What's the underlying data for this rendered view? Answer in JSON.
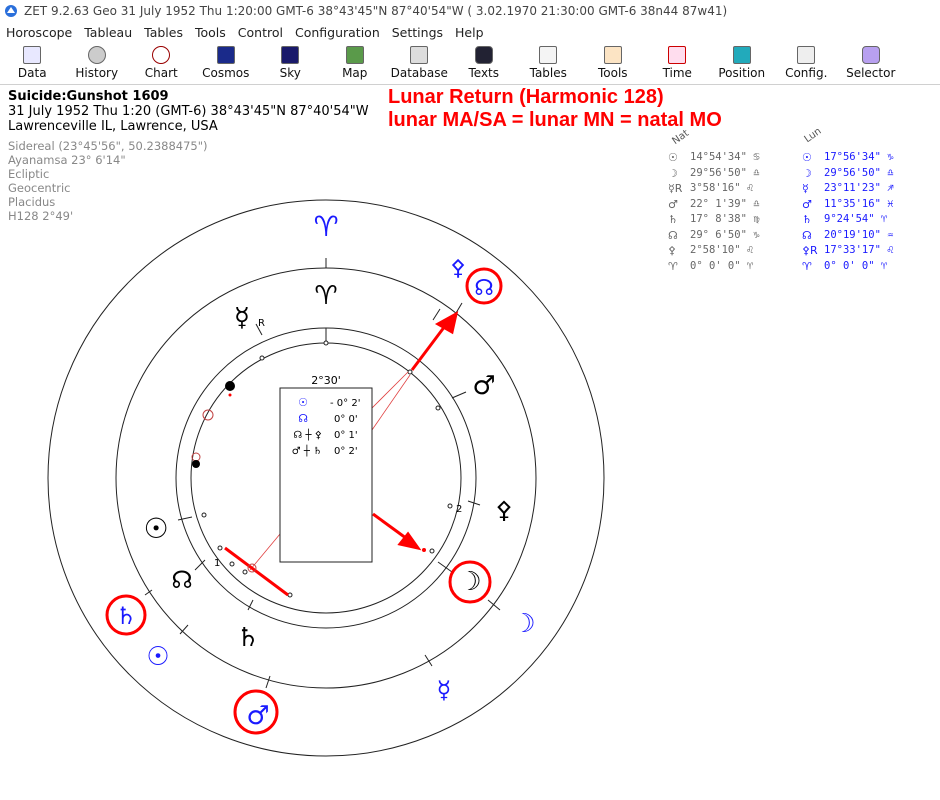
{
  "window": {
    "title": "ZET 9.2.63 Geo   31 July 1952  Thu   1:20:00 GMT-6 38°43'45\"N  87°40'54\"W  ( 3.02.1970  21:30:00 GMT-6 38n44 87w41)"
  },
  "menu": [
    "Horoscope",
    "Tableau",
    "Tables",
    "Tools",
    "Control",
    "Configuration",
    "Settings",
    "Help"
  ],
  "toolbar": [
    "Data",
    "History",
    "Chart",
    "Cosmos",
    "Sky",
    "Map",
    "Database",
    "Texts",
    "Tables",
    "Tools",
    "Time",
    "Position",
    "Config.",
    "Selector"
  ],
  "chart_header": {
    "name": "Suicide:Gunshot 1609",
    "line2": "31 July 1952  Thu   1:20 (GMT-6) 38°43'45\"N  87°40'54\"W",
    "line3": "Lawrenceville IL, Lawrence, USA"
  },
  "chart_settings": [
    "Sidereal (23°45'56\", 50.2388475\")",
    "Ayanamsa 23° 6'14\"",
    "Ecliptic",
    "Geocentric",
    "Placidus",
    "H128   2°49'"
  ],
  "annotation": {
    "line1": "Lunar Return (Harmonic 128)",
    "line2": "lunar MA/SA = lunar MN = natal MO"
  },
  "table_headers": {
    "natal": "Nat",
    "lunar": "Lun"
  },
  "natal_positions": [
    {
      "sym": "☉",
      "val": "14°54'34\" ♋"
    },
    {
      "sym": "☽",
      "val": "29°56'50\" ♎"
    },
    {
      "sym": "☿R",
      "val": " 3°58'16\" ♌"
    },
    {
      "sym": "♂",
      "val": "22° 1'39\" ♎"
    },
    {
      "sym": "♄",
      "val": "17° 8'38\" ♍"
    },
    {
      "sym": "☊",
      "val": "29° 6'50\" ♑"
    },
    {
      "sym": "⚴",
      "val": " 2°58'10\" ♌"
    },
    {
      "sym": "♈",
      "val": " 0° 0' 0\" ♈"
    }
  ],
  "lunar_positions": [
    {
      "sym": "☉",
      "val": "17°56'34\" ♑"
    },
    {
      "sym": "☽",
      "val": "29°56'50\" ♎"
    },
    {
      "sym": "☿",
      "val": "23°11'23\" ♐"
    },
    {
      "sym": "♂",
      "val": "11°35'16\" ♓"
    },
    {
      "sym": "♄",
      "val": " 9°24'54\" ♈"
    },
    {
      "sym": "☊",
      "val": "20°19'10\" ♒"
    },
    {
      "sym": "⚴R",
      "val": "17°33'17\" ♌"
    },
    {
      "sym": "♈",
      "val": " 0° 0' 0\" ♈"
    }
  ],
  "center_box": {
    "title": "2°30'",
    "rows": [
      {
        "sym": "☉",
        "val": "- 0° 2'"
      },
      {
        "sym": "☊",
        "val": "0° 0'"
      },
      {
        "sym": "☊ ┼ ⚴",
        "val": "0° 1'"
      },
      {
        "sym": "♂ ┼ ♄",
        "val": "0° 2'"
      }
    ]
  },
  "wheel_glyphs": {
    "aries_outer": "♈",
    "aries_inner": "♈",
    "mercury_natal": "☿",
    "retro_flag": "R",
    "mars_natal": "♂",
    "pholus_natal": "⚴",
    "moon_natal": "☽",
    "node_natal": "☊",
    "saturn_natal": "♄",
    "sun_natal": "☉",
    "pholus_lunar": "⚴",
    "node_lunar": "☊",
    "saturn_lunar": "♄",
    "sun_lunar": "☉",
    "mars_lunar": "♂",
    "mercury_lunar": "☿",
    "moon_lunar": "☽",
    "house_1": "1",
    "house_2": "2"
  },
  "colors": {
    "natal": "#000000",
    "lunar": "#1a1aff",
    "annotation": "#ff0000"
  }
}
